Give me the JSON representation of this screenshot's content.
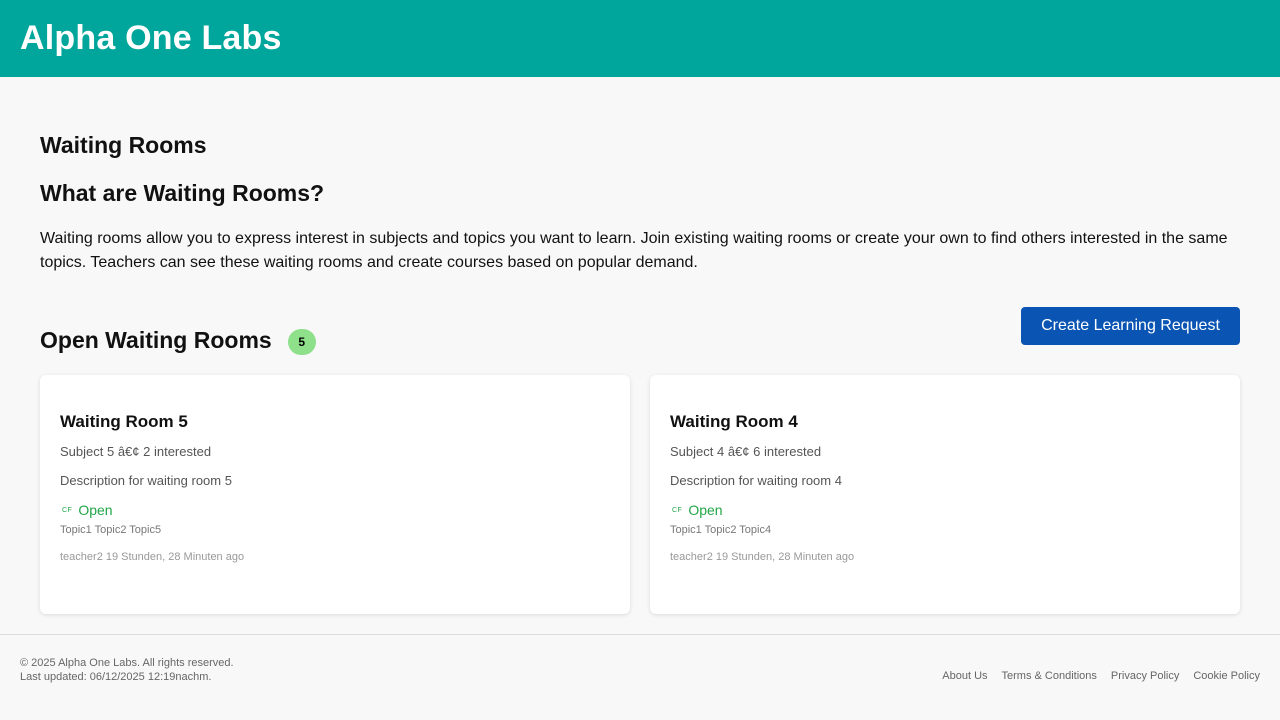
{
  "header": {
    "brand": "Alpha One Labs"
  },
  "main": {
    "page_title": "Waiting Rooms",
    "section_title": "What are Waiting Rooms?",
    "intro": "Waiting rooms allow you to express interest in subjects and topics you want to learn. Join existing waiting rooms or create your own to find others interested in the same topics. Teachers can see these waiting rooms and create courses based on popular demand.",
    "open_title": "Open Waiting Rooms",
    "open_count": "5",
    "create_button": "Create Learning Request"
  },
  "cards": [
    {
      "title": "Waiting Room 5",
      "meta": "Subject 5 â€¢ 2 interested",
      "description": "Description for waiting room 5",
      "status_icon": "CF",
      "status": "Open",
      "topics": "Topic1 Topic2 Topic5",
      "footer": "teacher2 19 Stunden, 28 Minuten ago"
    },
    {
      "title": "Waiting Room 4",
      "meta": "Subject 4 â€¢ 6 interested",
      "description": "Description for waiting room 4",
      "status_icon": "CF",
      "status": "Open",
      "topics": "Topic1 Topic2 Topic4",
      "footer": "teacher2 19 Stunden, 28 Minuten ago"
    }
  ],
  "footer": {
    "copyright": "© 2025 Alpha One Labs. All rights reserved.",
    "updated": "Last updated: 06/12/2025 12:19nachm.",
    "links": [
      "About Us",
      "Terms & Conditions",
      "Privacy Policy",
      "Cookie Policy"
    ]
  },
  "colors": {
    "header_bg": "#00a69b",
    "button_bg": "#0a55b3",
    "badge_bg": "#8ee08a",
    "status_open": "#22a547"
  }
}
